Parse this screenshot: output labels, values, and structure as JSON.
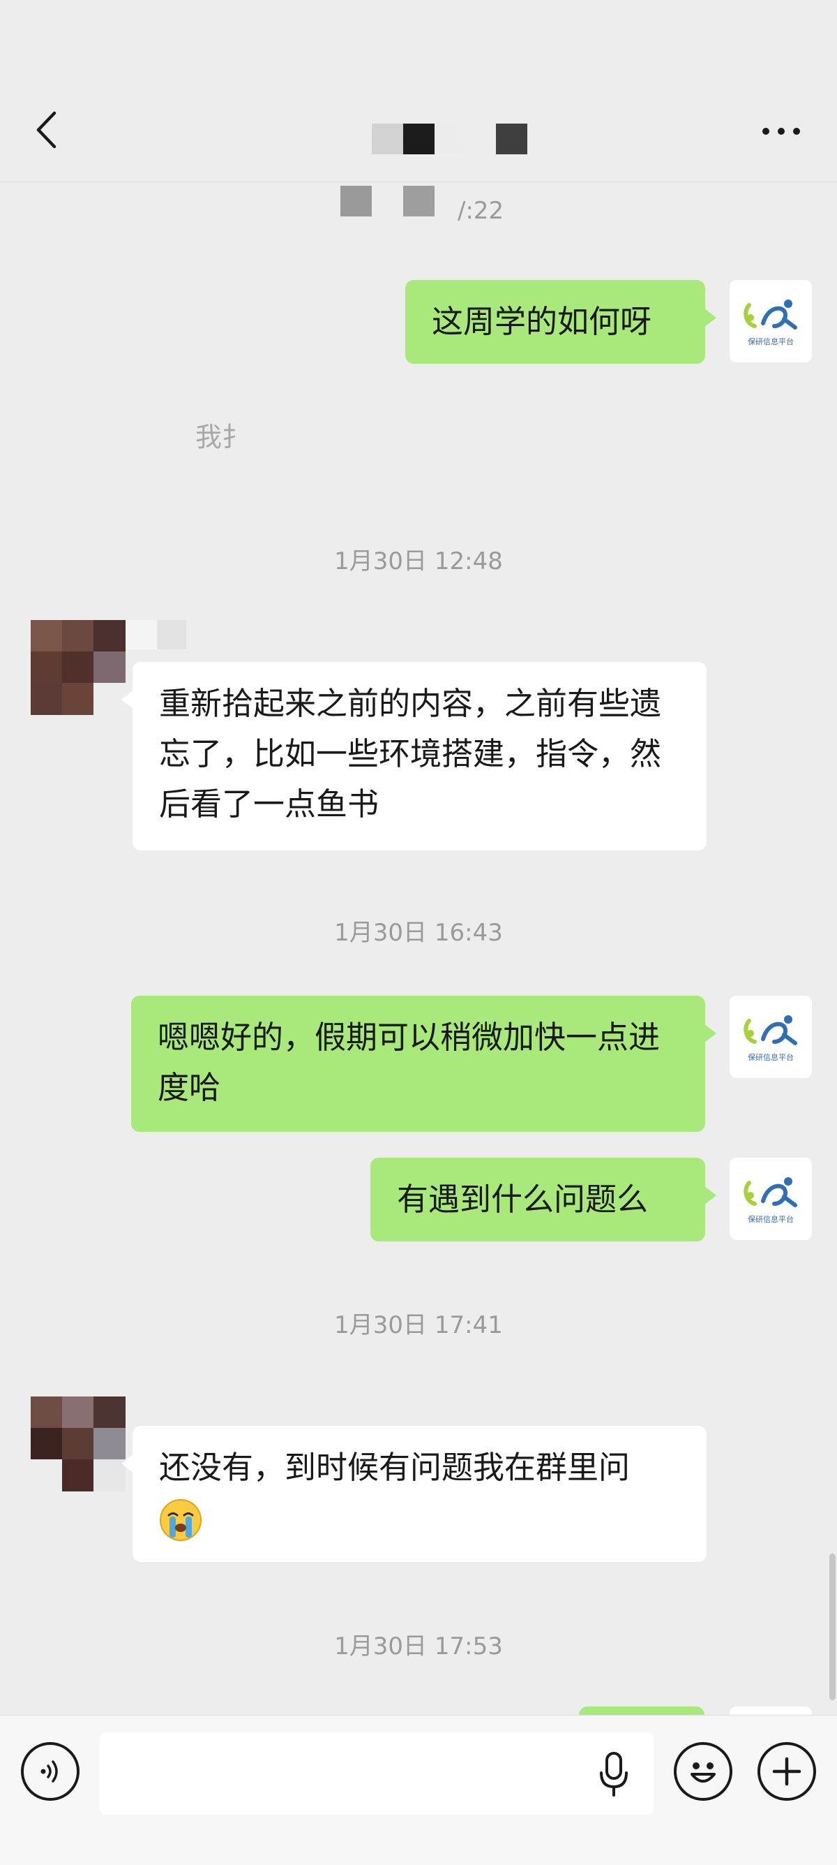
{
  "header": {
    "back_icon": "chevron-left-icon",
    "more_icon": "ellipsis-icon"
  },
  "partial_timestamp": "/:22",
  "recalled_hint": "我扌",
  "messages": [
    {
      "side": "me",
      "text": "这周学的如何呀"
    },
    {
      "side": "other",
      "text": "重新拾起来之前的内容，之前有些遗忘了，比如一些环境搭建，指令，然后看了一点鱼书"
    },
    {
      "side": "me",
      "text": "嗯嗯好的，假期可以稍微加快一点进度哈"
    },
    {
      "side": "me",
      "text": "有遇到什么问题么"
    },
    {
      "side": "other",
      "text": "还没有，到时候有问题我在群里问",
      "emoji": "crying-face-icon"
    }
  ],
  "timestamps": [
    "1月30日 12:48",
    "1月30日 16:43",
    "1月30日 17:41",
    "1月30日 17:53"
  ],
  "my_avatar": {
    "caption": "保研信息平台"
  },
  "input_bar": {
    "voice_icon": "voice-icon",
    "mic_icon": "microphone-icon",
    "emoji_icon": "smiley-icon",
    "plus_icon": "plus-icon",
    "input_value": ""
  },
  "colors": {
    "my_bubble": "#a9e87a",
    "other_bubble": "#ffffff",
    "background": "#ededed"
  }
}
